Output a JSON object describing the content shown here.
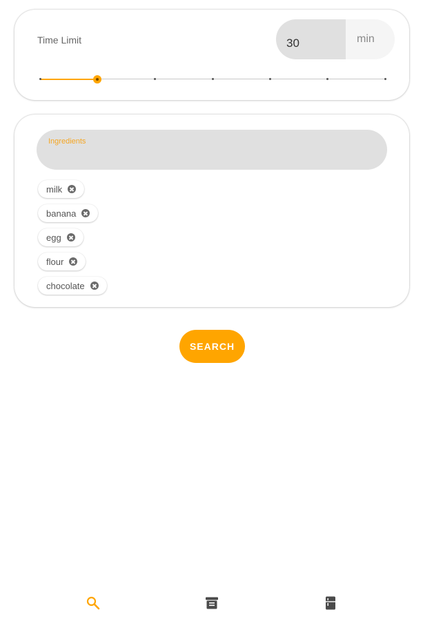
{
  "time_limit": {
    "label": "Time Limit",
    "value": "30",
    "unit": "min",
    "slider": {
      "ticks": 7,
      "selected_index": 1
    }
  },
  "ingredients": {
    "label": "Ingredients",
    "input_value": "",
    "chips": [
      "milk",
      "banana",
      "egg",
      "flour",
      "chocolate"
    ]
  },
  "search_button": {
    "label": "SEARCH"
  },
  "bottom_nav": {
    "items": [
      {
        "icon": "search-icon",
        "active": true
      },
      {
        "icon": "archive-icon",
        "active": false
      },
      {
        "icon": "fridge-icon",
        "active": false
      }
    ]
  },
  "colors": {
    "accent": "#ffa500",
    "inactive_icon": "#4a4a4a",
    "field_bg": "#e0e0e0"
  }
}
